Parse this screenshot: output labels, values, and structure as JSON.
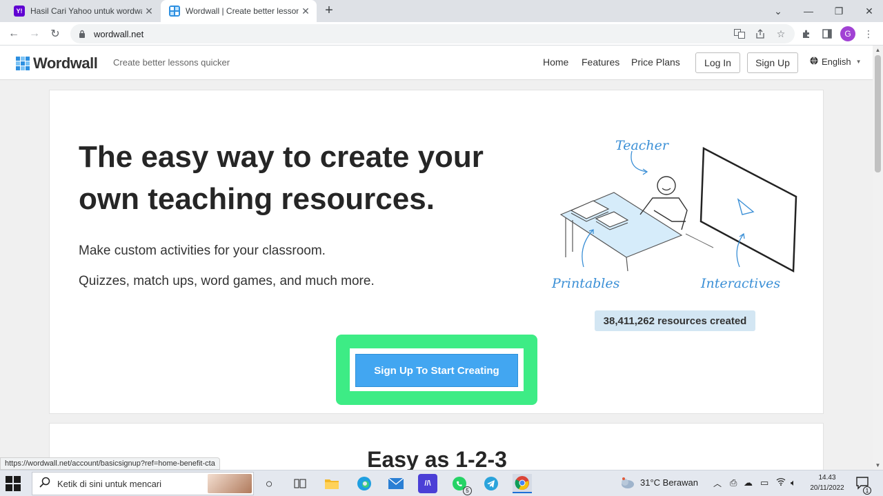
{
  "browser": {
    "tabs": [
      {
        "title": "Hasil Cari Yahoo untuk wordwall",
        "favicon": "yahoo-icon",
        "active": false
      },
      {
        "title": "Wordwall | Create better lessons",
        "favicon": "wordwall-icon",
        "active": true
      }
    ],
    "new_tab": "+",
    "address": "wordwall.net",
    "profile_initial": "G"
  },
  "site": {
    "logo_text": "Wordwall",
    "tagline": "Create better lessons quicker",
    "nav": [
      "Home",
      "Features",
      "Price Plans"
    ],
    "login": "Log In",
    "signup": "Sign Up",
    "language": "English"
  },
  "hero": {
    "headline": "The easy way to create your own teaching resources.",
    "sub1": "Make custom activities for your classroom.",
    "sub2": "Quizzes, match ups, word games, and much more.",
    "illustration_labels": {
      "teacher": "Teacher",
      "printables": "Printables",
      "interactives": "Interactives"
    },
    "resources_count": "38,411,262 resources created",
    "cta": "Sign Up To Start Creating"
  },
  "section2": {
    "title": "Easy as 1-2-3"
  },
  "status_url": "https://wordwall.net/account/basicsignup?ref=home-benefit-cta",
  "taskbar": {
    "search_placeholder": "Ketik di sini untuk mencari",
    "weather": "31°C  Berawan",
    "time": "14.43",
    "date": "20/11/2022",
    "whatsapp_badge": "5",
    "notification_badge": "1"
  },
  "colors": {
    "cta_highlight": "#3dec85",
    "cta_button": "#42a6f1",
    "badge_bg": "#d3e6f3",
    "logo_blue": "#2d8fe0"
  }
}
